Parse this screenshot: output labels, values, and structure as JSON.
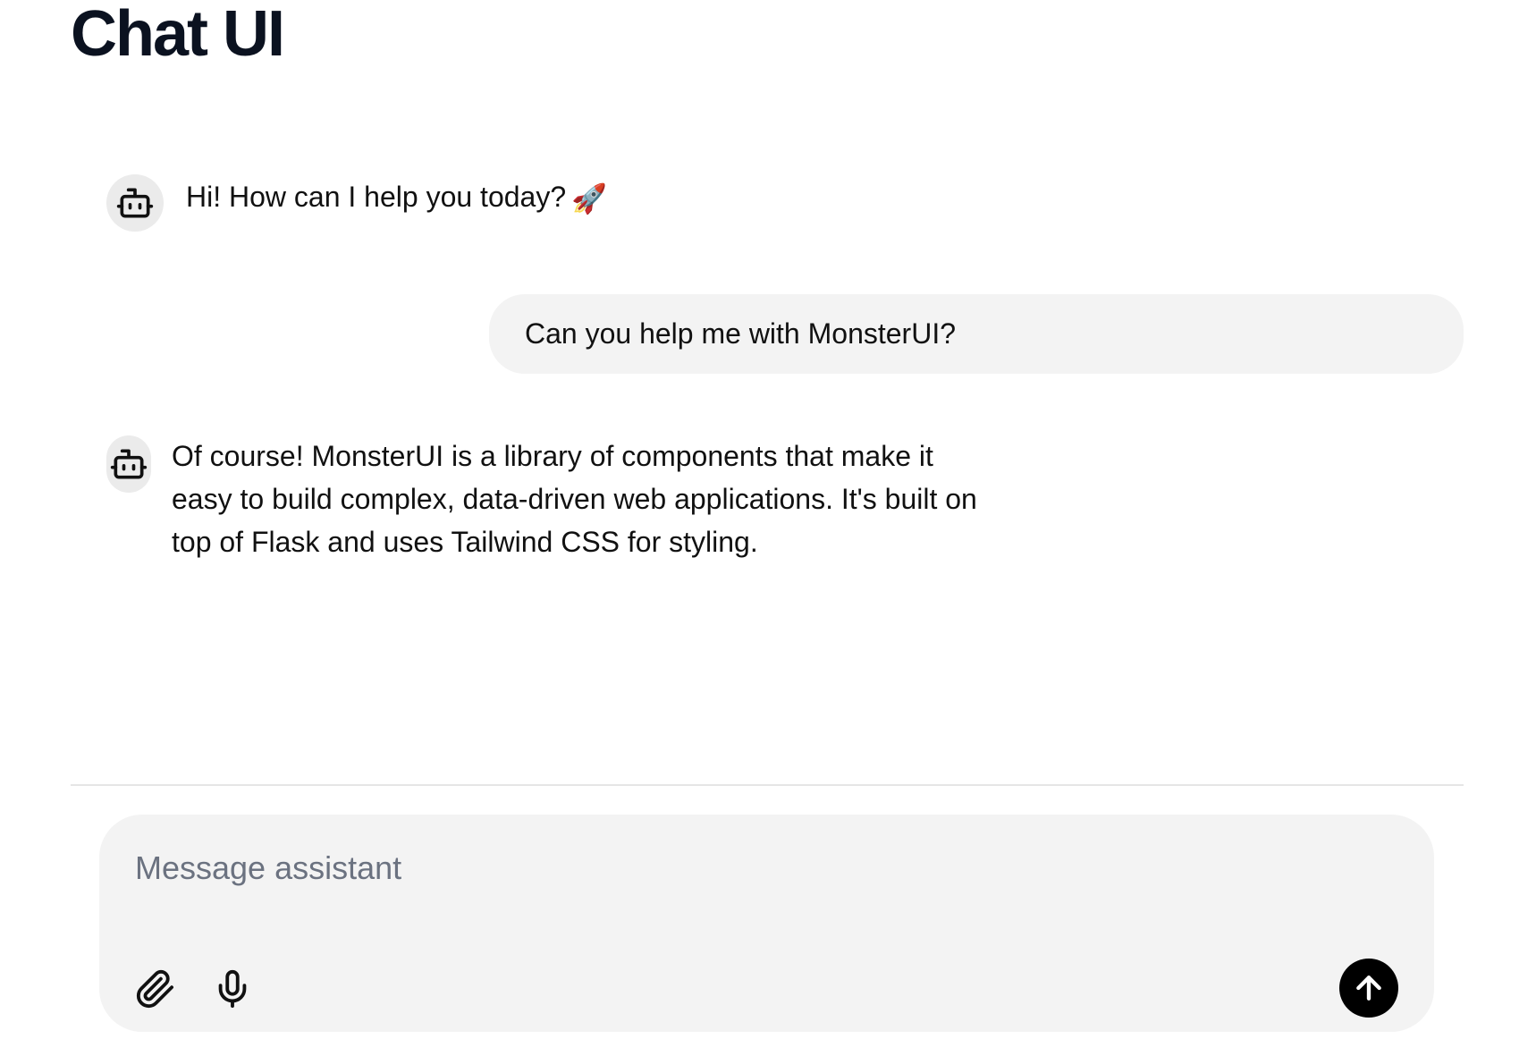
{
  "header": {
    "title": "Chat UI"
  },
  "messages": [
    {
      "role": "assistant",
      "text": "Hi! How can I help you today?",
      "emoji": "🚀"
    },
    {
      "role": "user",
      "text": "Can you help me with MonsterUI?"
    },
    {
      "role": "assistant",
      "text": "Of course! MonsterUI is a library of components that make it easy to build complex, data-driven web applications. It's built on top of Flask and uses Tailwind CSS for styling."
    }
  ],
  "composer": {
    "placeholder": "Message assistant",
    "value": ""
  },
  "icons": {
    "assistant_avatar": "bot-icon",
    "attach": "paperclip-icon",
    "mic": "microphone-icon",
    "send": "arrow-up-icon"
  },
  "colors": {
    "background": "#ffffff",
    "bubble": "#f3f3f3",
    "avatar": "#ebebeb",
    "send_button": "#000000",
    "placeholder": "#6b7280",
    "divider": "#e5e5e5"
  }
}
